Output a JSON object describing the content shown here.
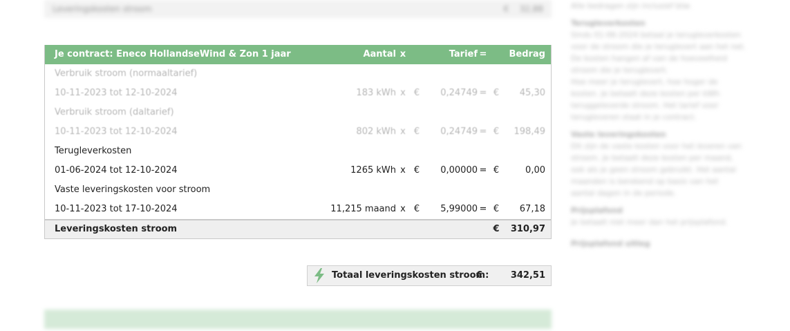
{
  "top_bar": {
    "label": "Leveringskosten stroom",
    "eur": "€",
    "amount": "32,88"
  },
  "sidebar": {
    "lines": [
      "Alle bedragen zijn inclusief btw.",
      "Terugleverkosten",
      "Sinds 01-06-2024 betaal je terugleverkosten",
      "voor de stroom die je teruglevert aan het net.",
      "De kosten hangen af van de hoeveelheid",
      "stroom die je teruglevert.",
      "Hoe meer je teruglevert, hoe hoger de",
      "kosten. Je betaalt deze kosten per kWh",
      "teruggeleverde stroom. Het tarief voor",
      "terugleveren staat in je contract.",
      "Vaste leveringskosten",
      "Dit zijn de vaste kosten voor het leveren van",
      "stroom. Je betaalt deze kosten per maand,",
      "ook als je geen stroom gebruikt. Het aantal",
      "maanden is berekend op basis van het",
      "aantal dagen in de periode.",
      "Prijsplafond",
      "Je betaalt niet meer dan het prijsplafond."
    ],
    "link": "Prijsplafond uitleg"
  },
  "contract": {
    "header": {
      "label": "Je contract:  Eneco HollandseWind & Zon 1 jaar",
      "qty": "Aantal",
      "x": "x",
      "tariff": "Tarief",
      "eq": "=",
      "amount": "Bedrag"
    },
    "rows": [
      {
        "type": "title",
        "faded": true,
        "label": "Verbruik stroom (normaaltarief)"
      },
      {
        "type": "line",
        "faded": true,
        "label": "10-11-2023 tot 12-10-2024",
        "qty": "183 kWh",
        "x": "x",
        "eur1": "€",
        "tariff": "0,24749",
        "eq": "=",
        "eur2": "€",
        "amount": "45,30"
      },
      {
        "type": "title",
        "faded": true,
        "label": "Verbruik stroom (daltarief)"
      },
      {
        "type": "line",
        "faded": true,
        "label": "10-11-2023 tot 12-10-2024",
        "qty": "802 kWh",
        "x": "x",
        "eur1": "€",
        "tariff": "0,24749",
        "eq": "=",
        "eur2": "€",
        "amount": "198,49"
      },
      {
        "type": "title",
        "faded": false,
        "label": "Terugleverkosten"
      },
      {
        "type": "line",
        "faded": false,
        "label": "01-06-2024 tot 12-10-2024",
        "qty": "1265 kWh",
        "x": "x",
        "eur1": "€",
        "tariff": "0,00000",
        "eq": "=",
        "eur2": "€",
        "amount": "0,00"
      },
      {
        "type": "title",
        "faded": false,
        "label": "Vaste leveringskosten voor stroom"
      },
      {
        "type": "line",
        "faded": false,
        "label": "10-11-2023 tot 17-10-2024",
        "qty": "11,215 maand",
        "x": "x",
        "eur1": "€",
        "tariff": "5,99000",
        "eq": "=",
        "eur2": "€",
        "amount": "67,18"
      }
    ],
    "total": {
      "label": "Leveringskosten stroom",
      "eur": "€",
      "amount": "310,97"
    }
  },
  "grand_total": {
    "label": "Totaal leveringskosten stroom:",
    "eur": "€",
    "amount": "342,51",
    "icon": "lightning-bolt-icon",
    "icon_color": "#7cbc85"
  },
  "colors": {
    "header_green": "#7cbc85",
    "total_grey": "#efefef"
  }
}
